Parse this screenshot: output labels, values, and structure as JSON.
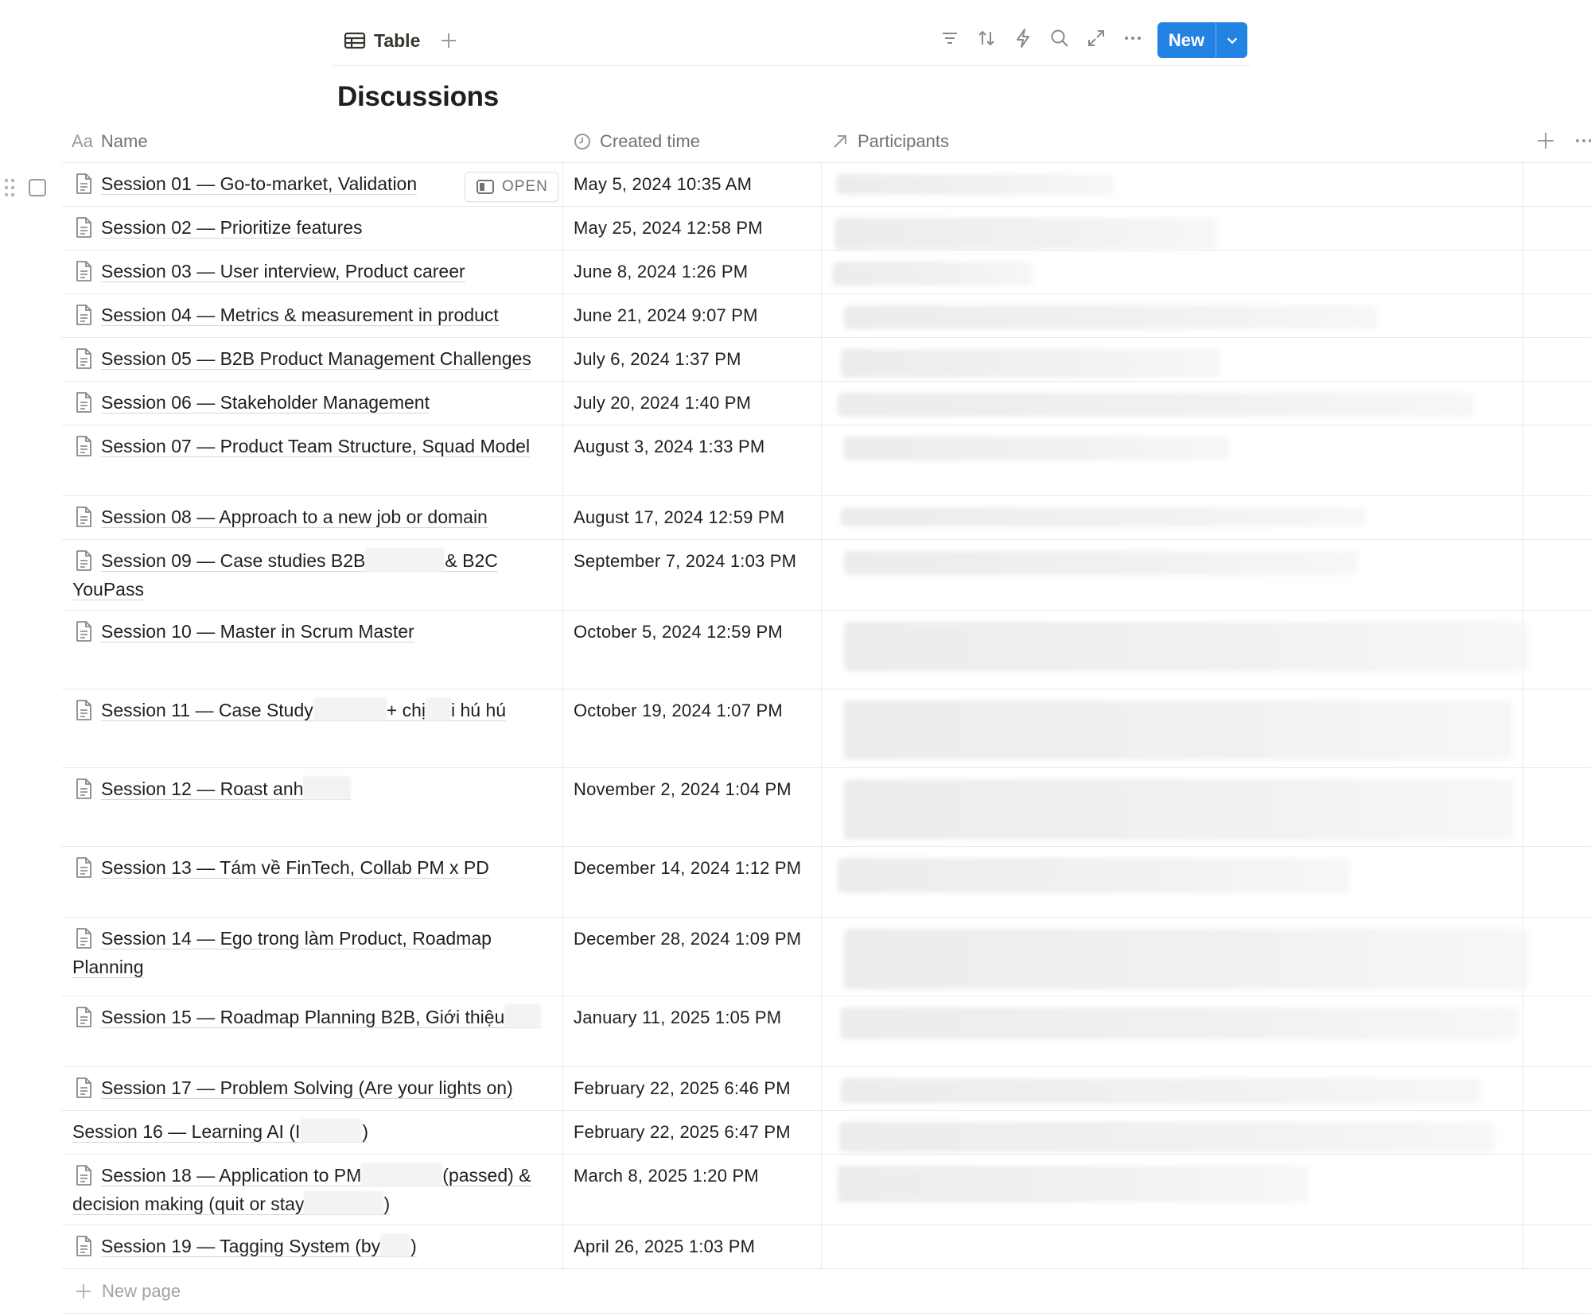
{
  "toolbar": {
    "view_tab_label": "Table",
    "new_button_label": "New",
    "icons": [
      "filter-icon",
      "sort-icon",
      "automation-icon",
      "search-icon",
      "expand-icon",
      "more-icon"
    ]
  },
  "database": {
    "title": "Discussions"
  },
  "columns": {
    "name": {
      "icon": "Aa",
      "label": "Name"
    },
    "created": {
      "label": "Created time"
    },
    "participants": {
      "label": "Participants"
    }
  },
  "open_button_label": "OPEN",
  "rows": [
    {
      "parts": [
        "Session 01 — Go-to-market, Validation"
      ],
      "created": "May 5, 2024 10:35 AM"
    },
    {
      "parts": [
        "Session 02 — Prioritize features"
      ],
      "created": "May 25, 2024 12:58 PM"
    },
    {
      "parts": [
        "Session 03 — User interview, Product career"
      ],
      "created": "June 8, 2024 1:26 PM"
    },
    {
      "parts": [
        "Session 04 — Metrics & measurement in product"
      ],
      "created": "June 21, 2024 9:07 PM"
    },
    {
      "parts": [
        "Session 05 — B2B Product Management Challenges"
      ],
      "created": "July 6, 2024 1:37 PM"
    },
    {
      "parts": [
        "Session 06 — Stakeholder Management"
      ],
      "created": "July 20, 2024 1:40 PM"
    },
    {
      "parts": [
        "Session 07 — Product Team Structure, Squad Model"
      ],
      "created": "August 3, 2024 1:33 PM"
    },
    {
      "parts": [
        "Session 08 — Approach to a new job or domain"
      ],
      "created": "August 17, 2024 12:59 PM"
    },
    {
      "parts": [
        "Session 09 — Case studies B2B",
        "",
        "& B2C YouPass"
      ],
      "created": "September 7, 2024 1:03 PM"
    },
    {
      "parts": [
        "Session 10 — Master in Scrum Master"
      ],
      "created": "October 5, 2024 12:59 PM"
    },
    {
      "parts": [
        "Session 11 — Case Study",
        "",
        "+ chị",
        "",
        "i hú hú"
      ],
      "created": "October 19, 2024 1:07 PM"
    },
    {
      "parts": [
        "Session 12 — Roast anh",
        ""
      ],
      "created": "November 2, 2024 1:04 PM"
    },
    {
      "parts": [
        "Session 13 — Tám về FinTech, Collab PM x PD"
      ],
      "created": "December 14, 2024 1:12 PM"
    },
    {
      "parts": [
        "Session 14 — Ego trong làm Product, Roadmap Planning"
      ],
      "created": "December 28, 2024 1:09 PM"
    },
    {
      "parts": [
        "Session 15 — Roadmap Planning B2B, Giới thiệu",
        ""
      ],
      "created": "January 11, 2025 1:05 PM"
    },
    {
      "parts": [
        "Session 17 — Problem Solving (Are your lights on)"
      ],
      "created": "February 22, 2025 6:46 PM"
    },
    {
      "parts": [
        "Session 16 — Learning AI (I",
        "",
        ")"
      ],
      "created": "February 22, 2025 6:47 PM"
    },
    {
      "parts": [
        "Session 18 — Application to PM",
        "",
        "(passed) & decision making (quit or stay",
        "",
        ")"
      ],
      "created": "March 8, 2025 1:20 PM"
    },
    {
      "parts": [
        "Session 19 — Tagging System (by",
        "",
        ")"
      ],
      "created": "April 26, 2025 1:03 PM"
    }
  ],
  "new_page_label": "New page"
}
